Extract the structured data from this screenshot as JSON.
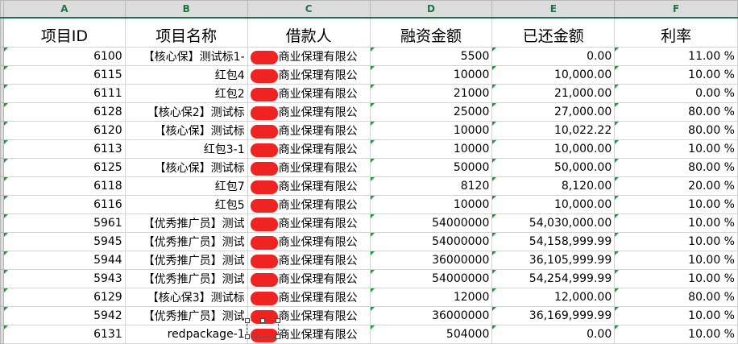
{
  "columns": [
    "A",
    "B",
    "C",
    "D",
    "E",
    "F"
  ],
  "headers": [
    "项目ID",
    "项目名称",
    "借款人",
    "融资金额",
    "已还金额",
    "利率"
  ],
  "borrower_suffix": "商业保理有限公",
  "rows": [
    {
      "id": "6100",
      "name": "【核心保】测试标1-",
      "amount": "5500",
      "repaid": "0.00",
      "rate": "11.00 %"
    },
    {
      "id": "6115",
      "name": "红包4",
      "amount": "10000",
      "repaid": "10,000.00",
      "rate": "10.00 %"
    },
    {
      "id": "6111",
      "name": "红包2",
      "amount": "21000",
      "repaid": "21,000.00",
      "rate": "0.00 %"
    },
    {
      "id": "6128",
      "name": "【核心保2】测试标",
      "amount": "25000",
      "repaid": "27,000.00",
      "rate": "80.00 %"
    },
    {
      "id": "6120",
      "name": "【核心保】测试标",
      "amount": "10000",
      "repaid": "10,022.22",
      "rate": "80.00 %"
    },
    {
      "id": "6113",
      "name": "红包3-1",
      "amount": "10000",
      "repaid": "10,000.00",
      "rate": "10.00 %"
    },
    {
      "id": "6125",
      "name": "【核心保】测试标",
      "amount": "50000",
      "repaid": "50,000.00",
      "rate": "80.00 %"
    },
    {
      "id": "6118",
      "name": "红包7",
      "amount": "8120",
      "repaid": "8,120.00",
      "rate": "20.00 %"
    },
    {
      "id": "6116",
      "name": "红包5",
      "amount": "10000",
      "repaid": "10,000.00",
      "rate": "10.00 %"
    },
    {
      "id": "5961",
      "name": "【优秀推广员】测试",
      "amount": "54000000",
      "repaid": "54,030,000.00",
      "rate": "10.00 %"
    },
    {
      "id": "5945",
      "name": "【优秀推广员】测试",
      "amount": "54000000",
      "repaid": "54,158,999.99",
      "rate": "10.00 %"
    },
    {
      "id": "5944",
      "name": "【优秀推广员】测试",
      "amount": "36000000",
      "repaid": "36,105,999.99",
      "rate": "10.00 %"
    },
    {
      "id": "5943",
      "name": "【优秀推广员】测试",
      "amount": "54000000",
      "repaid": "54,254,999.99",
      "rate": "10.00 %"
    },
    {
      "id": "6129",
      "name": "【核心保3】测试标",
      "amount": "12000",
      "repaid": "12,000.00",
      "rate": "80.00 %"
    },
    {
      "id": "5942",
      "name": "【优秀推广员】测试",
      "amount": "36000000",
      "repaid": "36,169,999.99",
      "rate": "10.00 %"
    },
    {
      "id": "6131",
      "name": "redpackage-1",
      "amount": "504000",
      "repaid": "0.00",
      "rate": "10.00 %"
    }
  ],
  "colors": {
    "header_bg": "#dcdcdc",
    "header_text": "#217346",
    "indicator": "#1a9c3a",
    "redaction": "#f02323"
  }
}
